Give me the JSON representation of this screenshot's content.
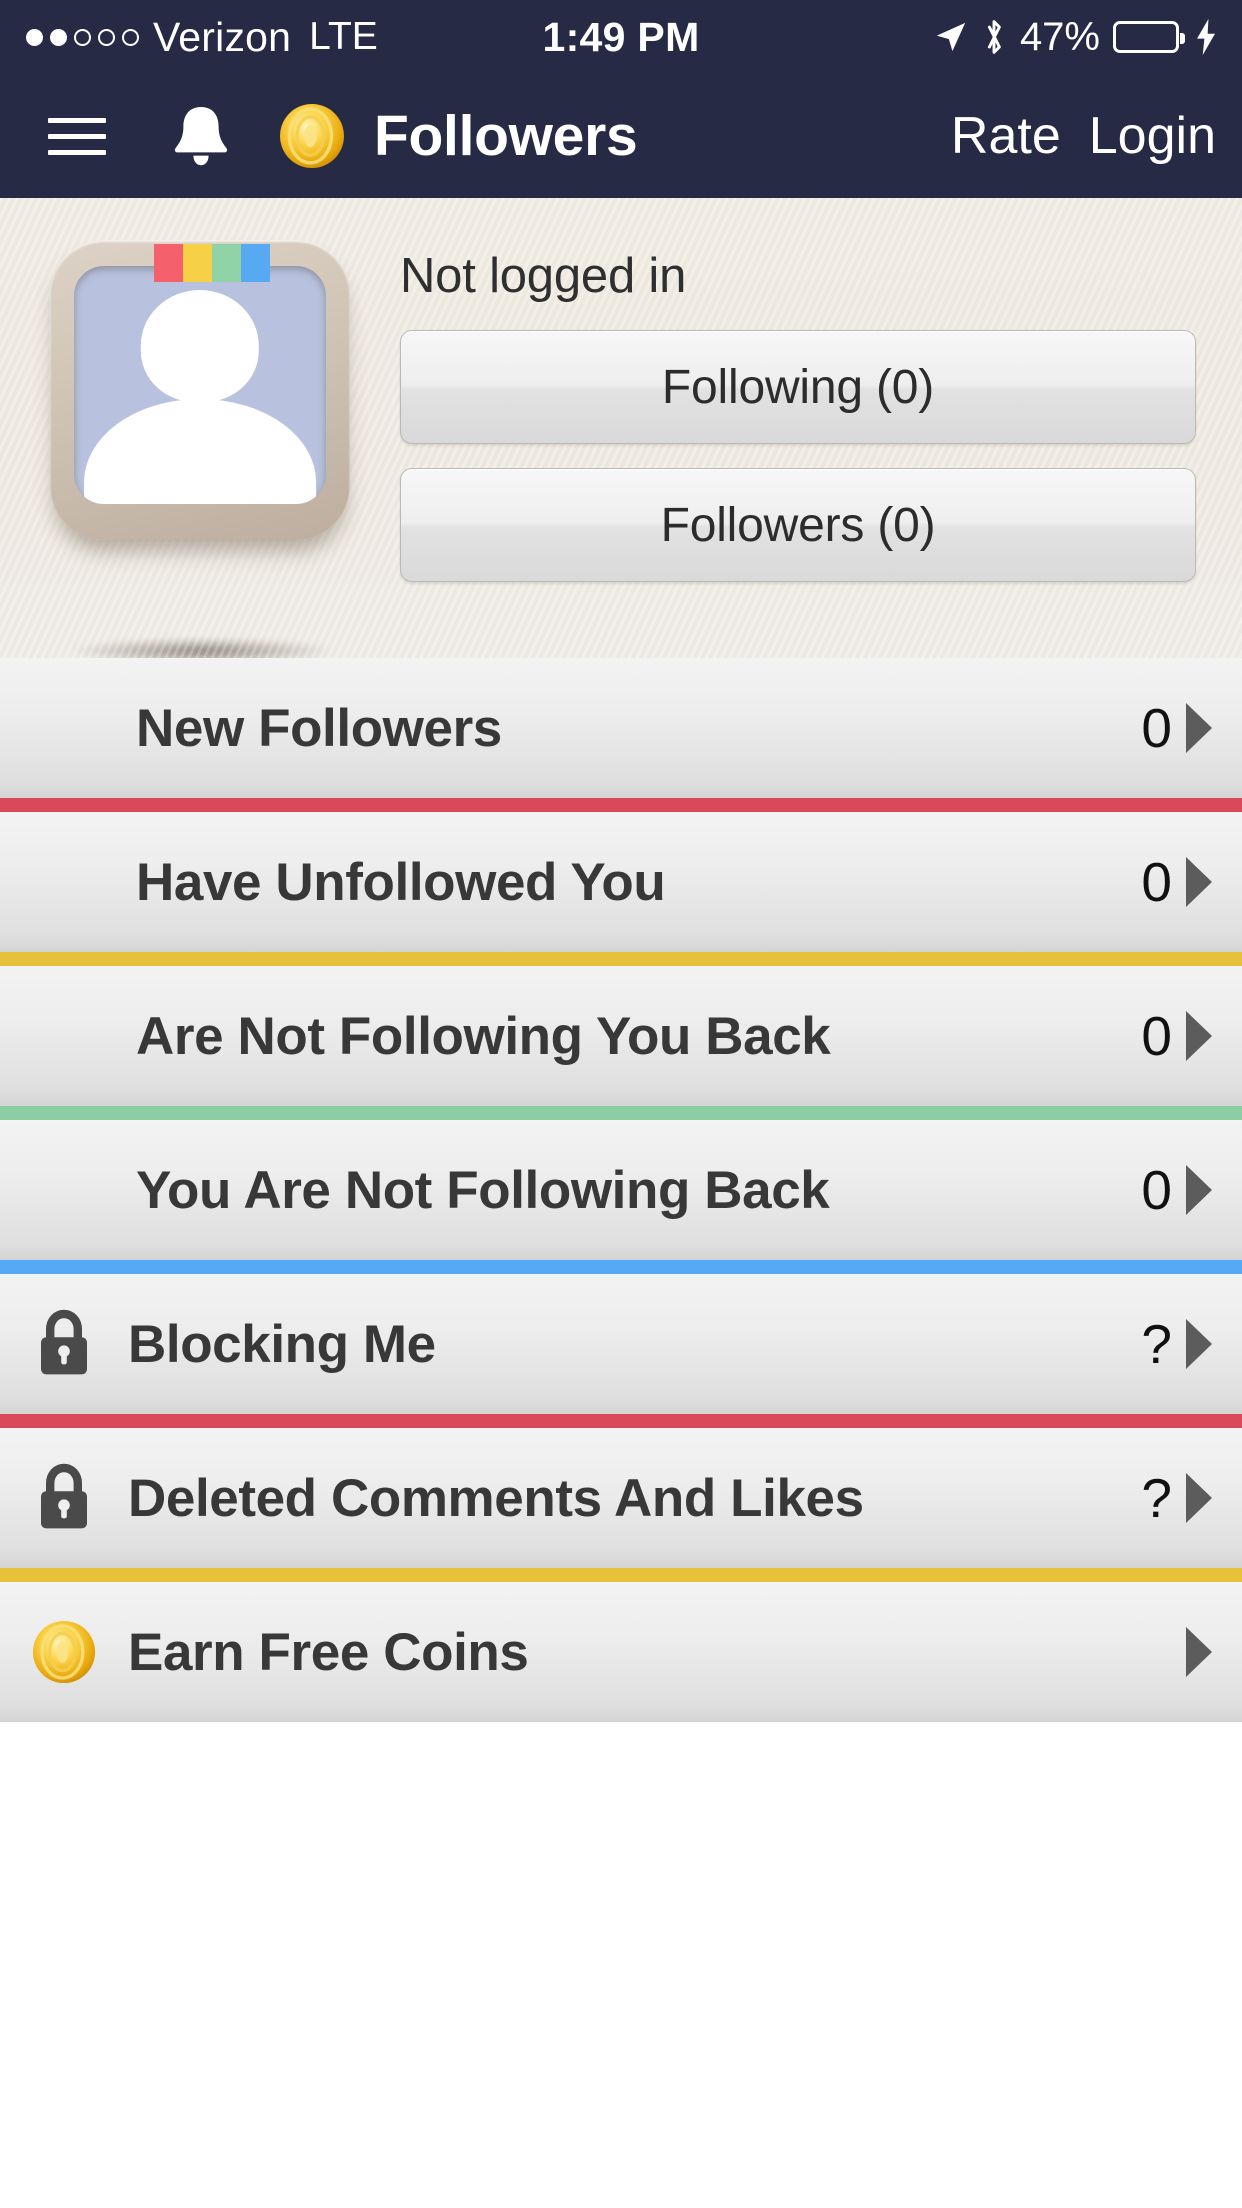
{
  "status_bar": {
    "signal_dots_total": 5,
    "signal_dots_filled": 2,
    "carrier": "Verizon",
    "network": "LTE",
    "time": "1:49 PM",
    "battery_percent": "47%",
    "battery_level": 47,
    "battery_color": "#4cd964",
    "icons": [
      "location-arrow-icon",
      "bluetooth-icon",
      "battery-icon",
      "charging-bolt-icon"
    ]
  },
  "nav_bar": {
    "menu_icon": "hamburger-menu-icon",
    "bell_icon": "notification-bell-icon",
    "coin_icon": "gold-coin-icon",
    "title": "Followers",
    "rate_label": "Rate",
    "login_label": "Login",
    "background_color": "#262a44"
  },
  "profile": {
    "avatar_icon": "default-person-avatar",
    "status_text": "Not logged in",
    "following_label": "Following (0)",
    "followers_label": "Followers (0)",
    "tab_colors": [
      "#f4606b",
      "#f6d046",
      "#8fd3a6",
      "#57aaf2"
    ]
  },
  "list": {
    "rows": [
      {
        "label": "New Followers",
        "value": "0",
        "icon": null,
        "separator": "#d9485b"
      },
      {
        "label": "Have Unfollowed You",
        "value": "0",
        "icon": null,
        "separator": "#e6c139"
      },
      {
        "label": "Are Not Following You Back",
        "value": "0",
        "icon": null,
        "separator": "#8dcda3"
      },
      {
        "label": "You Are Not Following Back",
        "value": "0",
        "icon": null,
        "separator": "#55aaf5"
      },
      {
        "label": "Blocking Me",
        "value": "?",
        "icon": "lock-icon",
        "separator": "#d9485b"
      },
      {
        "label": "Deleted Comments And Likes",
        "value": "?",
        "icon": "lock-icon",
        "separator": "#e6c139"
      },
      {
        "label": "Earn Free Coins",
        "value": "",
        "icon": "gold-coin-icon",
        "separator": null
      }
    ],
    "chevron_icon": "chevron-right-icon"
  }
}
